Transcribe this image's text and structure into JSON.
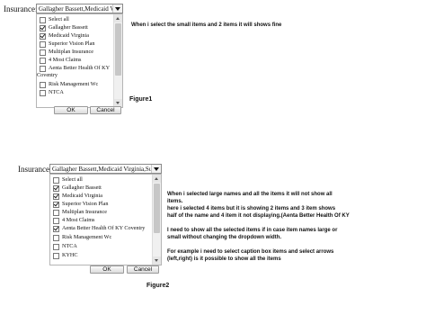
{
  "figure1": {
    "label": "Insurance:",
    "selected_value": "Gallagher Bassett,Medicaid Virginia",
    "items": [
      {
        "label": "Select all",
        "checked": false
      },
      {
        "label": "Gallagher Bassett",
        "checked": true
      },
      {
        "label": "Medicaid Virginia",
        "checked": true
      },
      {
        "label": "Superior Vision Plan",
        "checked": false
      },
      {
        "label": "Multiplan Insurance",
        "checked": false
      },
      {
        "label": "4 Most Claims",
        "checked": false
      },
      {
        "label": "Aenta Better Health Of KY",
        "checked": false
      },
      {
        "label": "Risk Management Wc",
        "checked": false
      },
      {
        "label": "NTCA",
        "checked": false
      }
    ],
    "coventry_wrap": "Coventry",
    "ok_label": "OK",
    "cancel_label": "Cancel",
    "note": "When i select the small items and 2 items it will shows fine",
    "caption": "Figure1"
  },
  "figure2": {
    "label": "Insurance:",
    "selected_value": "Gallagher Bassett,Medicaid Virginia,Superior",
    "items": [
      {
        "label": "Select all",
        "checked": false
      },
      {
        "label": "Gallagher Bassett",
        "checked": true
      },
      {
        "label": "Medicaid Virginia",
        "checked": true
      },
      {
        "label": "Superior Vision Plan",
        "checked": true
      },
      {
        "label": "Multiplan Insurance",
        "checked": false
      },
      {
        "label": "4 Most Claims",
        "checked": false
      },
      {
        "label": "Aenta Better Health Of KY Coventry",
        "checked": true
      },
      {
        "label": "Risk Management Wc",
        "checked": false
      },
      {
        "label": "NTCA",
        "checked": false
      },
      {
        "label": "KYHC",
        "checked": false
      }
    ],
    "ok_label": "OK",
    "cancel_label": "Cancel",
    "note": [
      "When i selected large names and all the items it will not show all",
      "items.",
      "here i selected 4 items but it is showing 2 items and 3 item shows",
      "half of the name and 4 item it not displaying.(Aenta Better Health Of KY",
      "",
      "I need to show all the selected items if in case item names large or",
      "small without changing the dropdown width.",
      "",
      "For example i need to select caption box items and select arrows",
      "(left,right) is it possible to show all the items"
    ],
    "caption": "Figure2"
  }
}
